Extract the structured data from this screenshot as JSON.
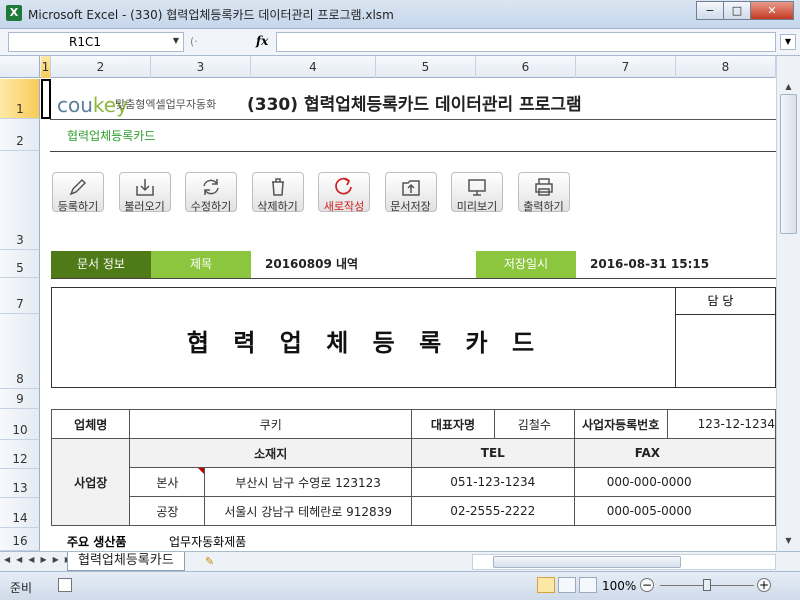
{
  "window": {
    "title": "Microsoft Excel - (330) 협력업체등록카드 데이터관리 프로그램.xlsm",
    "app_icon": "X",
    "minimize": "−",
    "restore": "□",
    "close": "✕"
  },
  "formula_bar": {
    "name_box": "R1C1",
    "fx_label": "fx",
    "formula": ""
  },
  "columns": [
    "1",
    "2",
    "3",
    "4",
    "5",
    "6",
    "7",
    "8"
  ],
  "rows": [
    "1",
    "2",
    "3",
    "5",
    "7",
    "8",
    "9",
    "10",
    "12",
    "13",
    "14",
    "16"
  ],
  "header": {
    "logo_main": "cou",
    "logo_accent": "key",
    "logo_sub": "맞춤형엑셀업무자동화",
    "title": "(330) 협력업체등록카드 데이터관리 프로그램",
    "subtitle": "협력업체등록카드"
  },
  "toolbar": [
    {
      "label": "등록하기",
      "icon": "pencil-icon"
    },
    {
      "label": "불러오기",
      "icon": "download-icon"
    },
    {
      "label": "수정하기",
      "icon": "refresh-icon"
    },
    {
      "label": "삭제하기",
      "icon": "trash-icon"
    },
    {
      "label": "새로작성",
      "icon": "new-icon"
    },
    {
      "label": "문서저장",
      "icon": "upload-icon"
    },
    {
      "label": "미리보기",
      "icon": "monitor-icon"
    },
    {
      "label": "출력하기",
      "icon": "printer-icon"
    }
  ],
  "doc_info": {
    "section_label": "문서 정보",
    "title_label": "제목",
    "title_value": "20160809 내역",
    "saved_label": "저장일시",
    "saved_value": "2016-08-31 15:15"
  },
  "card": {
    "title": "협 력 업 체 등 록 카 드",
    "approval_label": "담 당"
  },
  "company": {
    "name_label": "업체명",
    "name_value": "쿠키",
    "ceo_label": "대표자명",
    "ceo_value": "김철수",
    "bizno_label": "사업자등록번호",
    "bizno_value": "123-12-1234",
    "site_label": "사업장",
    "addr_label": "소재지",
    "tel_label": "TEL",
    "fax_label": "FAX",
    "sites": [
      {
        "type": "본사",
        "address": "부산시 남구 수영로 123123",
        "tel": "051-123-1234",
        "fax": "000-000-0000"
      },
      {
        "type": "공장",
        "address": "서울시 강남구 테헤란로 912839",
        "tel": "02-2555-2222",
        "fax": "000-005-0000"
      }
    ],
    "products_label": "주요 생산품",
    "products_value": "업무자동화제품"
  },
  "sheet_tabs": {
    "active": "협력업체등록카드"
  },
  "status": {
    "text": "준비",
    "zoom": "100%"
  }
}
